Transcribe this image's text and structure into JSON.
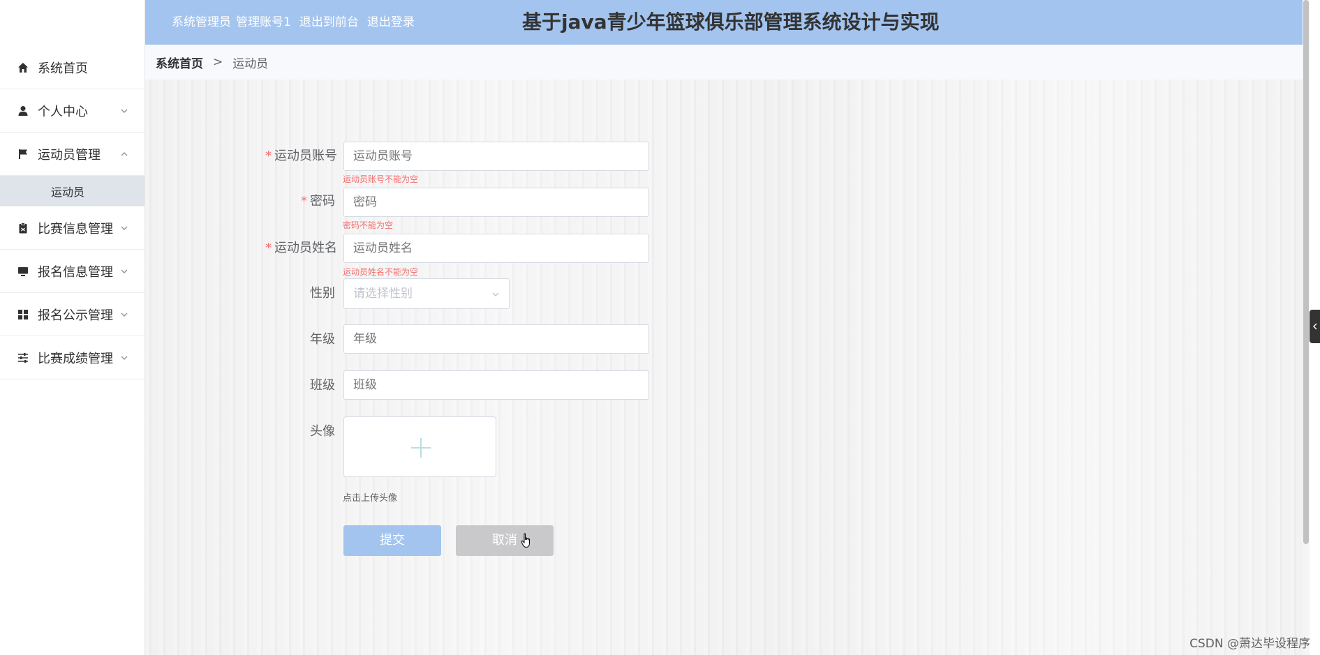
{
  "sidebar": {
    "items": [
      {
        "label": "系统首页",
        "icon": "home-icon"
      },
      {
        "label": "个人中心",
        "icon": "user-icon"
      },
      {
        "label": "运动员管理",
        "icon": "flag-icon"
      },
      {
        "label": "比赛信息管理",
        "icon": "clipboard-icon"
      },
      {
        "label": "报名信息管理",
        "icon": "monitor-icon"
      },
      {
        "label": "报名公示管理",
        "icon": "grid-icon"
      },
      {
        "label": "比赛成绩管理",
        "icon": "sliders-icon"
      }
    ],
    "subitem": {
      "label": "运动员"
    }
  },
  "header": {
    "role": "系统管理员",
    "account": "管理账号1",
    "to_front": "退出到前台",
    "logout": "退出登录",
    "title": "基于java青少年篮球俱乐部管理系统设计与实现"
  },
  "breadcrumb": {
    "home": "系统首页",
    "sep": ">",
    "current": "运动员"
  },
  "form": {
    "account": {
      "label": "运动员账号",
      "placeholder": "运动员账号",
      "error": "运动员账号不能为空"
    },
    "password": {
      "label": "密码",
      "placeholder": "密码",
      "error": "密码不能为空"
    },
    "name": {
      "label": "运动员姓名",
      "placeholder": "运动员姓名",
      "error": "运动员姓名不能为空"
    },
    "gender": {
      "label": "性别",
      "placeholder": "请选择性别"
    },
    "grade": {
      "label": "年级",
      "placeholder": "年级"
    },
    "class": {
      "label": "班级",
      "placeholder": "班级"
    },
    "avatar": {
      "label": "头像",
      "tip": "点击上传头像"
    },
    "submit": "提交",
    "cancel": "取消"
  },
  "required_mark": "*",
  "watermark": "CSDN @萧达毕设程序",
  "colors": {
    "header_bg": "#a3c4ef",
    "submit_bg": "#a3c4ef",
    "error": "#f56c6c",
    "cancel_bg": "#c9c9cc"
  }
}
